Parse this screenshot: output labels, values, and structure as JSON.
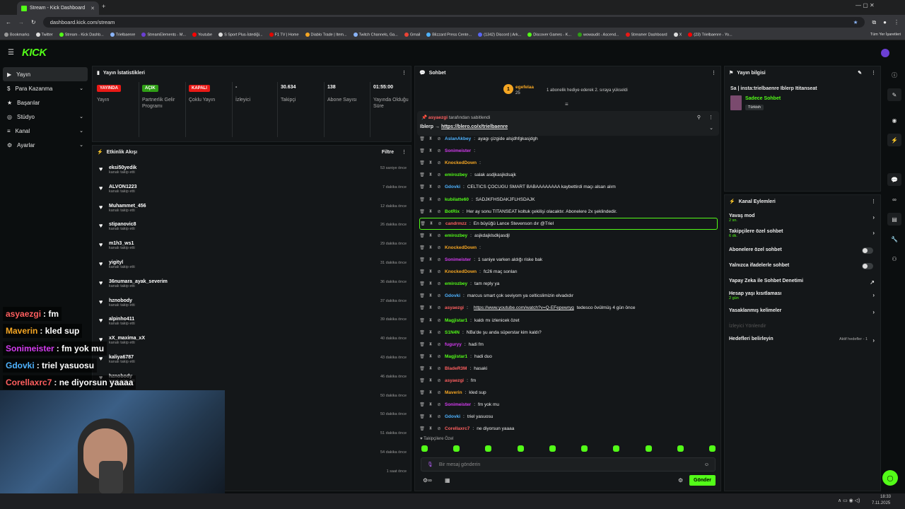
{
  "browser": {
    "tab_title": "Stream - Kick Dashboard",
    "url": "dashboard.kick.com/stream",
    "bookmarks": [
      "Bookmarks",
      "Twitter",
      "Stream - Kick Dashb...",
      "Trielbaenre",
      "StreamElements - M...",
      "Youtube",
      "S Sport Plus-İstediği...",
      "F1 TV | Home",
      "Diablo Trade | Item...",
      "Twitch Channels, Ga...",
      "Gmail",
      "Blizzard Press Cente...",
      "(1342) Discord | Ark...",
      "Discover Games - K...",
      "wowaudit - Ascend...",
      "Streamer Dashboard",
      "X",
      "(23) Trielbaenre - Yo..."
    ],
    "all_bookmarks": "Tüm Yer İşaretleri"
  },
  "nav": {
    "items": [
      {
        "label": "Yayın",
        "active": true
      },
      {
        "label": "Para Kazanma"
      },
      {
        "label": "Başarılar"
      },
      {
        "label": "Stüdyo"
      },
      {
        "label": "Kanal"
      },
      {
        "label": "Ayarlar"
      }
    ]
  },
  "stats": {
    "title": "Yayın İstatistikleri",
    "cols": [
      {
        "badge": "YAYINDA",
        "badge_color": "#e91916",
        "label": "Yayın"
      },
      {
        "badge": "AÇIK",
        "badge_color": "#2f9e16",
        "label": "Partnerlik Gelir Programı"
      },
      {
        "badge": "KAPALI",
        "badge_color": "#e91916",
        "label": "Çoklu Yayın"
      },
      {
        "value": "-",
        "label": "İzleyici"
      },
      {
        "value": "30.634",
        "label": "Takipçi"
      },
      {
        "value": "138",
        "label": "Abone Sayısı"
      },
      {
        "value": "01:55:00",
        "label": "Yayında Olduğu Süre"
      }
    ]
  },
  "feed": {
    "title": "Etkinlik Akışı",
    "filter": "Filtre",
    "sub": "kanalı takip etti",
    "items": [
      {
        "name": "eksi50yedik",
        "time": "53 saniye önce"
      },
      {
        "name": "ALVON1223",
        "time": "7 dakika önce"
      },
      {
        "name": "Muhammet_456",
        "time": "12 dakika önce"
      },
      {
        "name": "stipanovic8",
        "time": "26 dakika önce"
      },
      {
        "name": "m1h3_ws1",
        "time": "29 dakika önce"
      },
      {
        "name": "yigityl",
        "time": "31 dakika önce"
      },
      {
        "name": "36numara_ayak_severim",
        "time": "36 dakika önce"
      },
      {
        "name": "hznobody",
        "time": "37 dakika önce"
      },
      {
        "name": "alpinho411",
        "time": "39 dakika önce"
      },
      {
        "name": "xX_maxima_xX",
        "time": "40 dakika önce"
      },
      {
        "name": "kaliya6787",
        "time": "43 dakika önce"
      },
      {
        "name": "hznobody",
        "time": "46 dakika önce"
      },
      {
        "name": "",
        "time": "50 dakika önce"
      },
      {
        "name": "",
        "time": "50 dakika önce"
      },
      {
        "name": "",
        "time": "51 dakika önce"
      },
      {
        "name": "",
        "time": "54 dakika önce"
      },
      {
        "name": "",
        "time": "1 saat önce"
      }
    ]
  },
  "chat": {
    "title": "Sohbet",
    "gift": {
      "user": "egefelaa",
      "count": "25",
      "rank": "1",
      "text": "1 abonelik hediye ederek 2. sıraya yükseldi"
    },
    "pinned": {
      "by": "asyaezgi",
      "by_suffix": "tarafından sabitlendi",
      "prefix": "Iblerp →",
      "link": "https://blero.co/x/trielbaenre"
    },
    "messages": [
      {
        "user": "AslanAkbey",
        "color": "#4fb3ff",
        "text": "ayagı çizgide alsjdhfgkasjdgh"
      },
      {
        "user": "Sonimeister",
        "color": "#d43cf0",
        "text": ""
      },
      {
        "user": "KnockedDown",
        "color": "#f5a623",
        "text": ""
      },
      {
        "user": "emirozbey",
        "color": "#53fc18",
        "text": "salak asdjkasjkdsajk"
      },
      {
        "user": "Gdovki",
        "color": "#4fb3ff",
        "text": "CELTICS ÇOCUGU SMART BABAAAAAAAA kaybettirdi maçı alsan alım"
      },
      {
        "user": "kubilatte60",
        "color": "#53fc18",
        "text": "SADJKFHSDAKJFLHSDAJK"
      },
      {
        "user": "BotRix",
        "color": "#53fc18",
        "text": "Her ay sonu TITANSEAT koltuk çekilişi olacaktır. Abonelere 2x şeklindedir."
      },
      {
        "user": "candrmzz",
        "color": "#ff5f5f",
        "text": "En büyüğü Lance Stevenson dır @Triel",
        "hl": true
      },
      {
        "user": "emirozbey",
        "color": "#53fc18",
        "text": "asjkdajklsdkjasdjl"
      },
      {
        "user": "KnockedDown",
        "color": "#f5a623",
        "text": ""
      },
      {
        "user": "Sonimeister",
        "color": "#d43cf0",
        "text": "1 saniye varken aldığı riske bak"
      },
      {
        "user": "KnockedDown",
        "color": "#f5a623",
        "text": "fc26 maç sonları"
      },
      {
        "user": "emirozbey",
        "color": "#53fc18",
        "text": "tam reply ya"
      },
      {
        "user": "Gdovki",
        "color": "#4fb3ff",
        "text": "marcus smart çok seviyom ya celticslimizin elvadıdır"
      },
      {
        "user": "asyaezgi",
        "color": "#ff5f5f",
        "text": "",
        "link": "https://www.youtube.com/watch?v=Q-EFepewryg",
        "after": "tedesco övülmüş 4 gün önce"
      },
      {
        "user": "Magjistar1",
        "color": "#53fc18",
        "text": "kaldı mı izlenicek özet"
      },
      {
        "user": "S1N4N",
        "color": "#53fc18",
        "text": "NBa'de şu anda süperstar kim kaldı?"
      },
      {
        "user": "fuguryy",
        "color": "#d43cf0",
        "text": "hadi fm"
      },
      {
        "user": "Magjistar1",
        "color": "#53fc18",
        "text": "hadi duo"
      },
      {
        "user": "BladeR3M",
        "color": "#ff5f5f",
        "text": "hasaki"
      },
      {
        "user": "asyaezgi",
        "color": "#ff5f5f",
        "text": "fm"
      },
      {
        "user": "Maverin",
        "color": "#f5a623",
        "text": "kled sup"
      },
      {
        "user": "Sonimeister",
        "color": "#d43cf0",
        "text": "fm yok mu"
      },
      {
        "user": "Gdovki",
        "color": "#4fb3ff",
        "text": "triel yasuosu"
      },
      {
        "user": "Corellaxrc7",
        "color": "#ff5f5f",
        "text": "ne diyorsun yaaaa"
      }
    ],
    "followers_only": "Takipçilere Özel",
    "input_placeholder": "Bir mesaj gönderin",
    "send": "Gönder"
  },
  "info": {
    "title": "Yayın bilgisi",
    "stream_title": "Sa | insta:trielbaenre Iblerp Ititanseat",
    "category": "Sadece Sohbet",
    "tag": "Türkish"
  },
  "actions": {
    "title": "Kanal Eylemleri",
    "rows": [
      {
        "label": "Yavaş mod",
        "sub": "2 sn."
      },
      {
        "label": "Takipçilere özel sohbet",
        "sub": "6 dk."
      },
      {
        "label": "Abonelere özel sohbet"
      },
      {
        "label": "Yalnızca ifadelerle sohbet"
      },
      {
        "label": "Yapay Zeka ile Sohbet Denetimi"
      },
      {
        "label": "Hesap yaşı kısıtlaması",
        "sub": "2 gün"
      },
      {
        "label": "Yasaklanmış kelimeler"
      },
      {
        "label": "İzleyici Yönlendir"
      },
      {
        "label": "Hedefleri belirleyin",
        "sub": "Aktif hedefler - 1"
      }
    ]
  },
  "overlay": [
    {
      "user": "asyaezgi",
      "color": "#ff5f5f",
      "text": ": fm"
    },
    {
      "user": "Maverin",
      "color": "#f5a623",
      "text": ": kled sup"
    },
    {
      "user": "Sonimeister",
      "color": "#d43cf0",
      "text": ": fm yok mu"
    },
    {
      "user": "Gdovki",
      "color": "#4fb3ff",
      "text": ": triel yasuosu"
    },
    {
      "user": "Corellaxrc7",
      "color": "#ff5f5f",
      "text": ": ne diyorsun yaaaa"
    }
  ],
  "taskbar": {
    "time": "18:33",
    "date": "7.11.2025"
  }
}
